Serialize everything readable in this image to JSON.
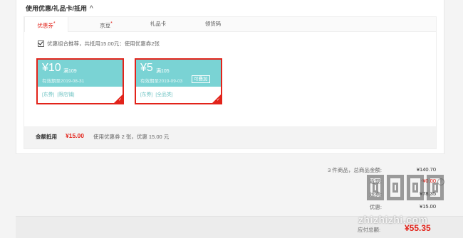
{
  "section": {
    "title": "使用优惠/礼品卡/抵用",
    "chevron_icon": "chevron-up-icon"
  },
  "tabs": [
    {
      "label": "优惠券",
      "mark": "*"
    },
    {
      "label": "京豆",
      "mark": "*"
    },
    {
      "label": "礼品卡",
      "mark": ""
    },
    {
      "label": "领货码",
      "mark": ""
    }
  ],
  "recommend": {
    "checked": true,
    "text": "优惠组合推荐，共抵用15.00元：使用优惠券2张"
  },
  "coupons": [
    {
      "amount": "¥10",
      "condition": "满109",
      "expiry": "有效期至2019-08-31",
      "usable_badge": "",
      "tags": [
        "[东券]",
        "[限店铺]"
      ],
      "selected": true
    },
    {
      "amount": "¥5",
      "condition": "满105",
      "expiry": "有效期至2019-09-03",
      "usable_badge": "可叠加",
      "tags": [
        "[东券]",
        "[全品类]"
      ],
      "selected": true
    }
  ],
  "summary": {
    "label": "金额抵用",
    "amount": "¥15.00",
    "description": "使用优惠券 2 张，优惠 15.00 元"
  },
  "totals": [
    {
      "label": "3 件商品，总商品金额:",
      "value": "¥140.70",
      "red": false
    },
    {
      "label": "返现:",
      "value": "-¥0.00",
      "red": true
    },
    {
      "label": "运费:",
      "value": "¥78.35",
      "red": false
    },
    {
      "label": "优惠:",
      "value": "¥15.00",
      "red": false
    }
  ],
  "footer": {
    "label": "应付总额:",
    "value": "¥55.35"
  },
  "watermark": {
    "text": "zhizhizhi.com"
  },
  "colors": {
    "accent": "#e2231a",
    "coupon_bg": "#7ad3d4"
  }
}
